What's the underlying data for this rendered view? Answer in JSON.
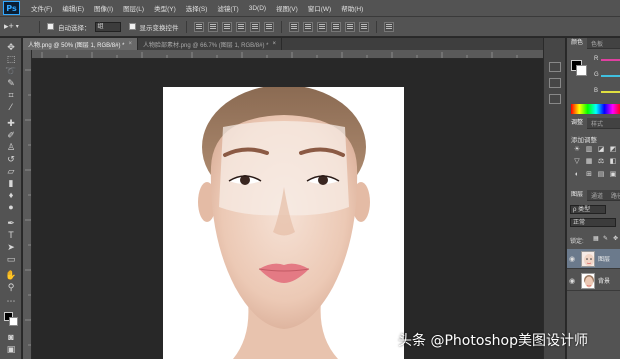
{
  "app": {
    "logo": "Ps"
  },
  "menu": [
    "文件(F)",
    "编辑(E)",
    "图像(I)",
    "图层(L)",
    "类型(Y)",
    "选择(S)",
    "滤镜(T)",
    "3D(D)",
    "视图(V)",
    "窗口(W)",
    "帮助(H)"
  ],
  "options": {
    "auto_select_label": "自动选择：",
    "auto_select_value": "组",
    "show_transform_label": "显示变换控件"
  },
  "tabs": [
    {
      "label": "人物",
      "suffix": ".png @ 50% (图层 1, RGB/8#) *",
      "close": "×",
      "active": true
    },
    {
      "label": "人物脸部素材",
      "suffix": ".png @ 66.7% (图层 1, RGB/8#) *",
      "close": "×",
      "active": false
    }
  ],
  "panels": {
    "color_tabs": [
      "颜色",
      "色板"
    ],
    "sliders": [
      "R",
      "G",
      "B"
    ],
    "slider_colors": [
      "#e040a0",
      "#40c0e0",
      "#e0e040"
    ],
    "adjust_tabs": [
      "调整",
      "样式"
    ],
    "adjust_title": "添加调整",
    "layers_tabs": [
      "图层",
      "通道",
      "路径"
    ],
    "filter_kind": "ρ 类型",
    "blend_mode": "正常",
    "lock_label": "锁定:",
    "layers": [
      {
        "name": "图层",
        "selected": true
      },
      {
        "name": "背景",
        "selected": false
      }
    ]
  },
  "watermark": "头条 @Photoshop美图设计师"
}
